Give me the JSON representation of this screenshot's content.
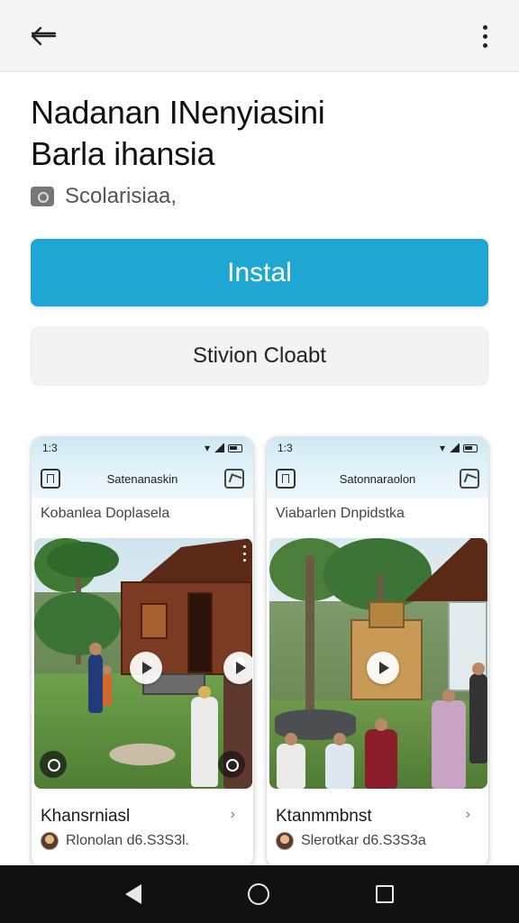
{
  "header": {
    "back_icon": "arrow-left-icon",
    "menu_icon": "more-vertical-icon"
  },
  "app": {
    "title_line1": "Nadanan INenyiasini",
    "title_line2": "Barla ihansia",
    "developer": "Scolarisiaa,",
    "developer_icon": "camera-icon"
  },
  "actions": {
    "install_label": "Instal",
    "secondary_label": "Stivion Cloabt"
  },
  "colors": {
    "install_bg": "#1ea7d3",
    "nav_bar": "#111111",
    "top_bar": "#f4f4f4"
  },
  "cards": [
    {
      "status_time": "1:3",
      "app_title": "Satenanaskin",
      "subtitle": "Kobanlea  Doplasela",
      "name": "Khansrniasl",
      "author": "Rlonolan  d6.S3S3l.",
      "arrow": "›"
    },
    {
      "status_time": "1:3",
      "app_title": "Satonnaraolon",
      "subtitle": "Viabarlen  Dnpidstka",
      "name": "Ktanmmbnst",
      "author": "Slerotkar  d6.S3S3a",
      "arrow": "›"
    }
  ]
}
